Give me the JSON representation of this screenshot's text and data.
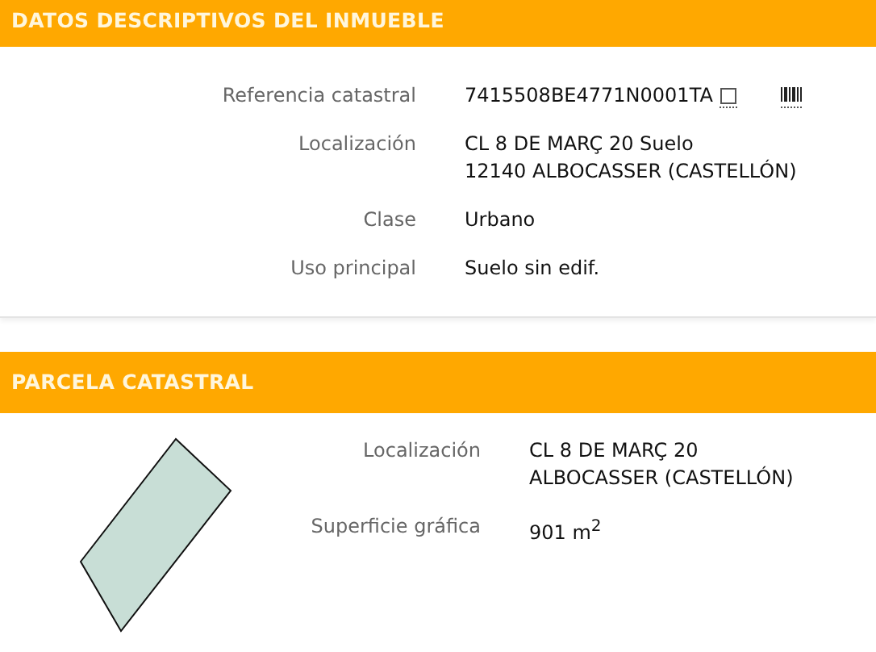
{
  "sections": [
    {
      "title": "DATOS DESCRIPTIVOS DEL INMUEBLE",
      "kind": "details",
      "rows": [
        {
          "label": "Referencia catastral",
          "lines": [
            "7415508BE4771N0001TA"
          ],
          "kind": "reference"
        },
        {
          "label": "Localización",
          "lines": [
            "CL 8 DE MARÇ 20 Suelo",
            "12140 ALBOCASSER (CASTELLÓN)"
          ],
          "kind": "text"
        },
        {
          "label": "Clase",
          "lines": [
            "Urbano"
          ],
          "kind": "text"
        },
        {
          "label": "Uso principal",
          "lines": [
            "Suelo sin edif."
          ],
          "kind": "text"
        }
      ]
    },
    {
      "title": "PARCELA CATASTRAL",
      "kind": "parcel",
      "rows": [
        {
          "label": "Localización",
          "lines": [
            "CL 8 DE MARÇ 20",
            "ALBOCASSER (CASTELLÓN)"
          ],
          "kind": "text"
        },
        {
          "label": "Superficie gráfica",
          "lines": [
            "901 m$^{2}$"
          ],
          "kind": "text"
        }
      ]
    }
  ]
}
